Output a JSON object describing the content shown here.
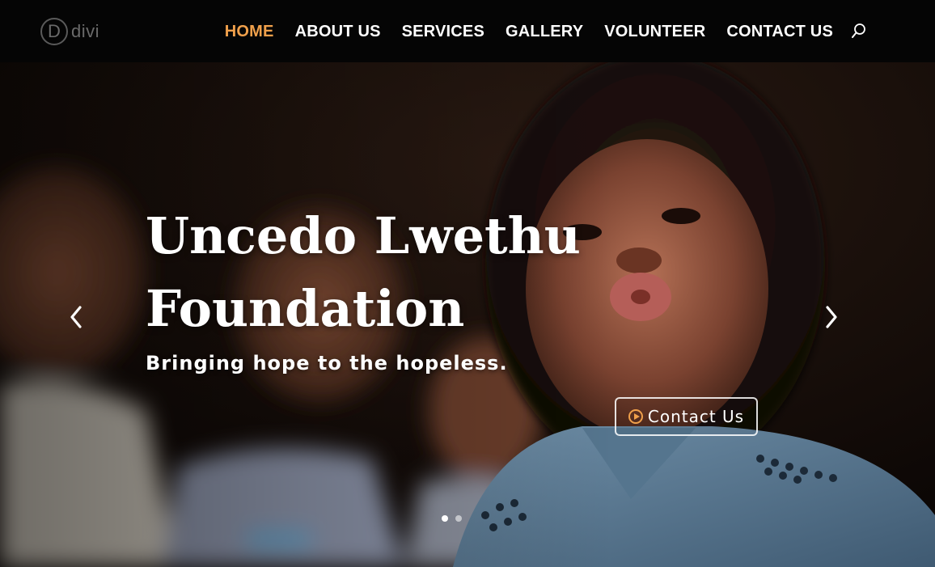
{
  "header": {
    "logo": {
      "mark": "D",
      "text": "divi"
    },
    "nav": [
      {
        "label": "HOME",
        "active": true
      },
      {
        "label": "ABOUT US",
        "active": false
      },
      {
        "label": "SERVICES",
        "active": false
      },
      {
        "label": "GALLERY",
        "active": false
      },
      {
        "label": "VOLUNTEER",
        "active": false
      },
      {
        "label": "CONTACT US",
        "active": false
      }
    ],
    "search_icon": "search-icon"
  },
  "hero": {
    "title": "Uncedo Lwethu Foundation",
    "subtitle": "Bringing hope to the hopeless.",
    "cta_label": "Contact Us",
    "cta_icon": "play-circle-icon",
    "slide_count": 2,
    "active_slide": 1
  },
  "colors": {
    "accent": "#f0a04b",
    "header_bg": "#050505",
    "text": "#ffffff"
  }
}
